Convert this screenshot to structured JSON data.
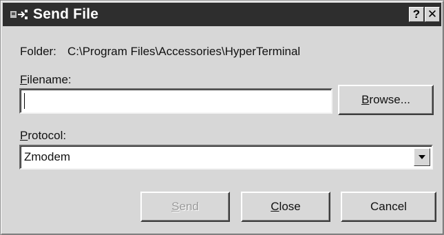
{
  "window": {
    "title": "Send File",
    "help_button": "?",
    "close_button": "✕"
  },
  "folder": {
    "label": "Folder:",
    "path": "C:\\Program Files\\Accessories\\HyperTerminal"
  },
  "filename": {
    "label_mnemonic": "F",
    "label_rest": "ilename:",
    "value": ""
  },
  "protocol": {
    "label_mnemonic": "P",
    "label_rest": "rotocol:",
    "selected": "Zmodem"
  },
  "buttons": {
    "browse_mnemonic": "B",
    "browse_rest": "rowse...",
    "send_mnemonic": "S",
    "send_rest": "end",
    "close_mnemonic": "C",
    "close_rest": "lose",
    "cancel": "Cancel"
  },
  "colors": {
    "titlebar": "#2e2e2e",
    "dialog": "#d7d7d7"
  }
}
